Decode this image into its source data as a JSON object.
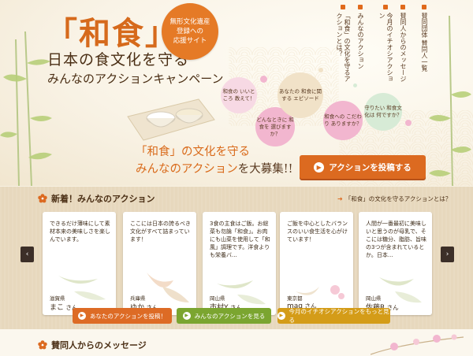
{
  "hero": {
    "title_main": "「和食」",
    "title_line1": "日本の食文化を守る",
    "title_line2": "みんなのアクションキャンペーン",
    "badge_lines": [
      "無形文化遺産",
      "登録への",
      "応援サイト"
    ],
    "bubbles": [
      "和食の いいところ 教えて！",
      "どんなときに 和食を 選びますか？",
      "あなたの 和食に関する エピソード",
      "和食への こだわり ありますか？",
      "守りたい 和食文化は 何ですか？"
    ],
    "headline_line1": "「和食」の文化を守る",
    "headline_line2_a": "みんなのアクション",
    "headline_line2_b": "を大募集!!",
    "cta_label": "アクションを投稿する",
    "cta_icon": "arrow-right-icon"
  },
  "nav": {
    "items": [
      "「和食」の文化を守るアクションとは？",
      "みんなのアクション",
      "今月のイチオシアクション",
      "賛同人からのメッセージ",
      "賛同団体 賛同人一覧"
    ]
  },
  "actions": {
    "title": "新着！みんなのアクション",
    "link_label": "「和食」の文化を守るアクションとは？",
    "prev_label": "‹",
    "next_label": "›",
    "cards": [
      {
        "text": "できるだけ薄味にして素材本来の美味しさを楽しんでいます。",
        "prefecture": "滋賀県",
        "name": "まこ",
        "suffix": "さん"
      },
      {
        "text": "ここには日本の誇るべき文化がすべて詰まっています！",
        "prefecture": "兵庫県",
        "name": "ゆか",
        "suffix": "さん"
      },
      {
        "text": "3食の主食はご飯。お総菜も勿論「和食」。お肉にも山菜を使用して「和風」調理です。洋食よりも栄養バ...",
        "prefecture": "岡山県",
        "name": "市村Y",
        "suffix": "さん"
      },
      {
        "text": "ご飯を中心としたバランスのいい食生活を心がけています！",
        "prefecture": "東京都",
        "name": "mag",
        "suffix": "さん"
      },
      {
        "text": "人間が一番最初に美味しいと思うのが母乳で、そこには糖分、脂肪、旨味の3つが含まれているとか。日本...",
        "prefecture": "岡山県",
        "name": "佐藤R",
        "suffix": "さん"
      }
    ],
    "buttons": [
      {
        "label": "あなたのアクションを投稿！"
      },
      {
        "label": "みんなのアクションを見る"
      },
      {
        "label": "今月のイチオシアクションをもっと見る"
      }
    ]
  },
  "supporters": {
    "title": "賛同人からのメッセージ"
  },
  "colors": {
    "accent_orange": "#dc6a20",
    "green": "#7ba530",
    "gold": "#d49c18",
    "panel_beige": "#e7d8bd"
  }
}
